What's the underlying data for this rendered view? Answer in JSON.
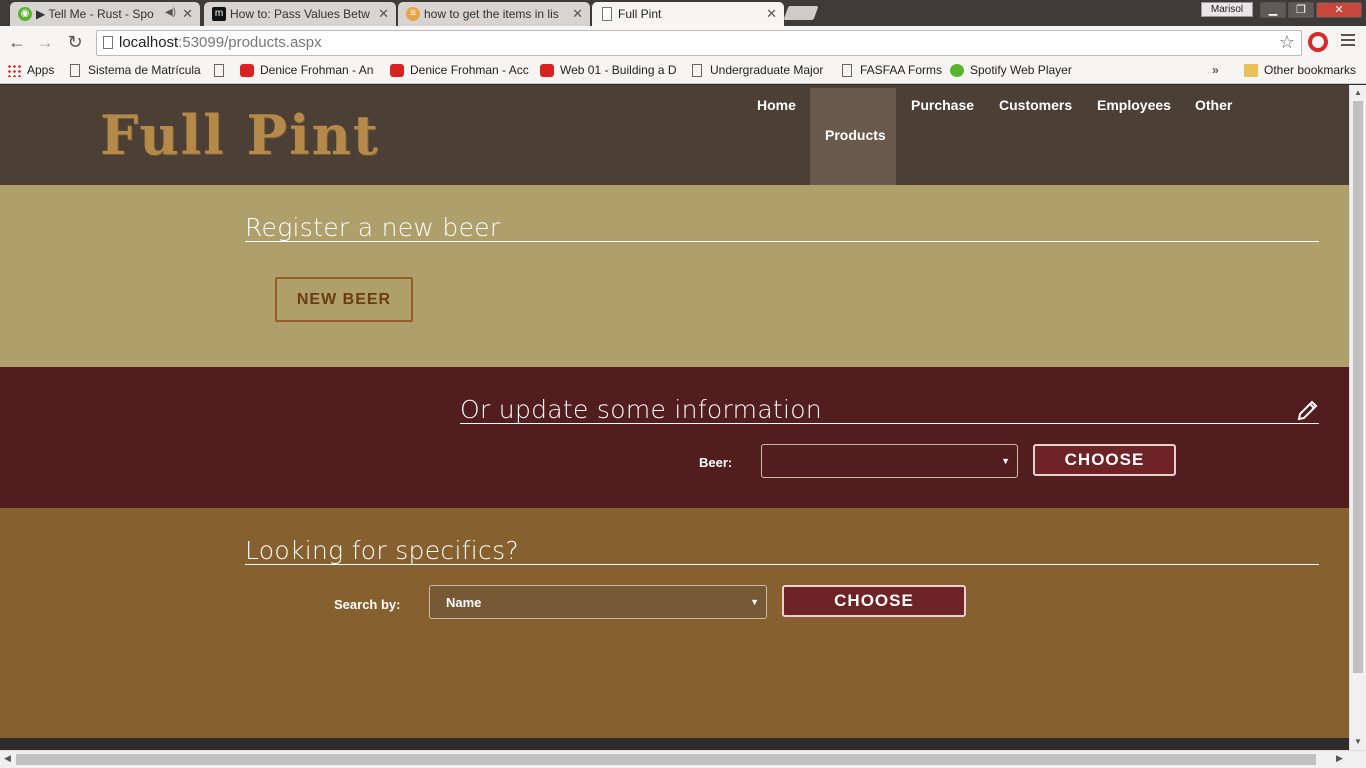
{
  "browser": {
    "tabs": [
      {
        "title": "▶ Tell Me - Rust - Spo",
        "icon": "spotify-icon"
      },
      {
        "title": "How to: Pass Values Betw",
        "icon": "m-icon"
      },
      {
        "title": "how to get the items in lis",
        "icon": "stack-icon"
      },
      {
        "title": "Full Pint",
        "icon": "page-icon"
      }
    ],
    "user": "Marisol",
    "url_host": "localhost",
    "url_path": ":53099/products.aspx",
    "bookmarks": [
      {
        "label": "Apps",
        "icon": "apps"
      },
      {
        "label": "Sistema de Matrícula",
        "icon": "doc"
      },
      {
        "label": "",
        "icon": "doc"
      },
      {
        "label": "Denice Frohman - An",
        "icon": "yt"
      },
      {
        "label": "Denice Frohman - Acc",
        "icon": "yt"
      },
      {
        "label": "Web 01 - Building a D",
        "icon": "yt"
      },
      {
        "label": "Undergraduate Major",
        "icon": "doc"
      },
      {
        "label": "FASFAA Forms",
        "icon": "doc"
      },
      {
        "label": "Spotify Web Player",
        "icon": "spot"
      }
    ],
    "more_bookmarks": "»",
    "other_bookmarks": "Other bookmarks"
  },
  "site": {
    "logo": "Full Pint",
    "nav": {
      "home": "Home",
      "products": "Products",
      "purchase": "Purchase",
      "customers": "Customers",
      "employees": "Employees",
      "other": "Other"
    }
  },
  "register": {
    "title": "Register a new beer",
    "button": "NEW BEER"
  },
  "update": {
    "title": "Or update some information",
    "beer_label": "Beer:",
    "beer_value": "",
    "button": "CHOOSE"
  },
  "search": {
    "title": "Looking for specifics?",
    "label": "Search by:",
    "value": "Name",
    "button": "CHOOSE"
  },
  "colors": {
    "header": "#4b3f36",
    "register_bg": "#ae9f6b",
    "update_bg": "#521d1e",
    "search_bg": "#86612f",
    "button_red": "#6e2326",
    "logo_gold": "#b5894a"
  }
}
